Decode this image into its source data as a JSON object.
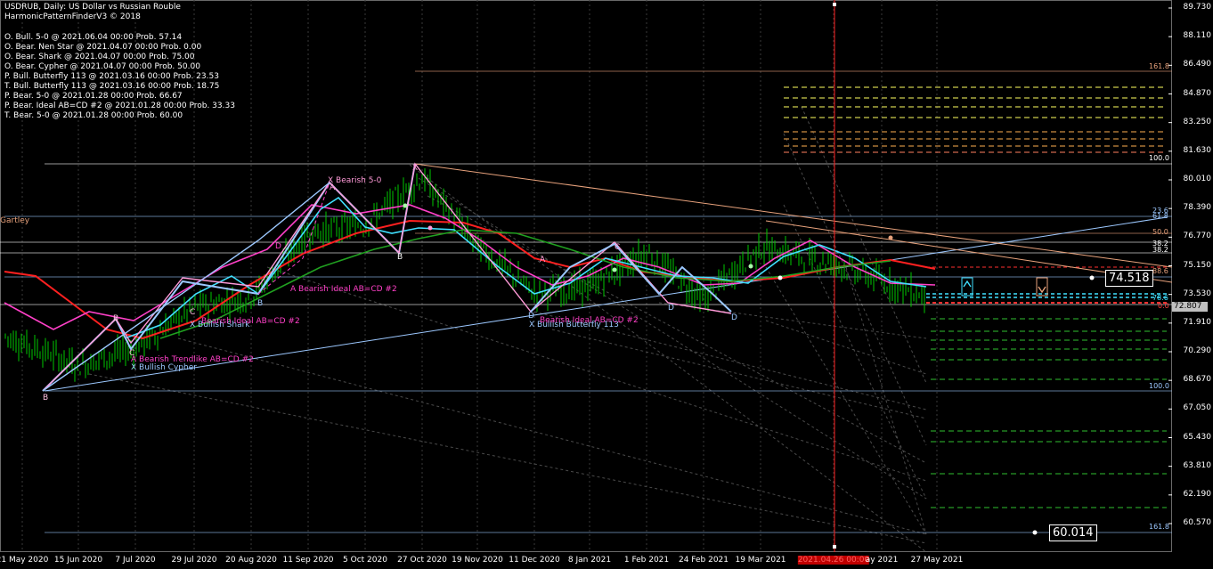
{
  "header": {
    "title": "USDRUB, Daily:  US Dollar vs Russian Rouble",
    "indicator": "HarmonicPatternFinderV3 © 2018"
  },
  "pattern_list": [
    "O. Bull. 5-0 @ 2021.06.04 00:00 Prob. 57.14",
    "O. Bear. Nen Star @ 2021.04.07 00:00 Prob. 0.00",
    "O. Bear. Shark @ 2021.04.07 00:00 Prob. 75.00",
    "O. Bear. Cypher @ 2021.04.07 00:00 Prob. 50.00",
    "P. Bull. Butterfly 113 @ 2021.03.16 00:00 Prob. 23.53",
    "T. Bull. Butterfly 113 @ 2021.03.16 00:00 Prob. 18.75",
    "P. Bear. 5-0 @ 2021.01.28 00:00 Prob. 66.67",
    "P. Bear. Ideal AB=CD #2 @ 2021.01.28 00:00 Prob. 33.33",
    "T. Bear. 5-0 @ 2021.01.28 00:00 Prob. 60.00"
  ],
  "price_axis": [
    "89.730",
    "88.110",
    "86.490",
    "84.870",
    "83.250",
    "81.630",
    "80.010",
    "78.390",
    "76.770",
    "75.150",
    "73.530",
    "71.910",
    "70.290",
    "68.670",
    "67.050",
    "65.430",
    "63.810",
    "62.190",
    "60.570"
  ],
  "time_axis": [
    "21 May 2020",
    "15 Jun 2020",
    "7 Jul 2020",
    "29 Jul 2020",
    "20 Aug 2020",
    "11 Sep 2020",
    "5 Oct 2020",
    "27 Oct 2020",
    "19 Nov 2020",
    "11 Dec 2020",
    "8 Jan 2021",
    "1 Feb 2021",
    "24 Feb 2021",
    "19 Mar 2021",
    "2021.04.26 00:00",
    "ay 2021",
    "27 May 2021"
  ],
  "current_price_label": "72.807",
  "price_boxes": {
    "upper": "74.518",
    "lower": "60.014"
  },
  "fib_labels": {
    "top_1618": "161.8",
    "top_100": "100.0",
    "l236": "23.6",
    "l618": "61.8",
    "l500": "50.0",
    "l382": "38.2",
    "l382b": "38.2",
    "l886": "88.6",
    "l786": "78.6",
    "l00": "0.0",
    "bot_100": "100.0",
    "bot_1618": "161.8"
  },
  "annotations": {
    "bearish_50": "X Bearish 5-0",
    "bearish_ideal_abcd": "A Bearish Ideal AB=CD #2",
    "bullish_shark": "X Bullish Shark",
    "bearish_ideal_abcd_2": "Bearish Ideal AB=CD #2",
    "bearish_trendlike": "A Bearish Trendlike AB=CD #2",
    "bullish_cypher": "X Bullish Cypher",
    "bullish_butterfly": "X Bullish Butterfly 113",
    "bearish_ideal_abcd_3": "Bearish Ideal AB=CD #2",
    "gartley": "Gartley",
    "pt_b1": "B",
    "pt_c1": "C",
    "pt_b2": "B",
    "pt_c2": "C",
    "pt_d1": "D",
    "pt_b3": "B",
    "pt_a1": "A",
    "pt_b4": "B",
    "pt_d2": "D",
    "pt_x1": "X",
    "pt_d3": "D",
    "pt_d4": "D",
    "pt_a2": "A",
    "pt_c3": "C"
  },
  "colors": {
    "background": "#000000",
    "bars": "#00c800",
    "red_ma": "#ff2020",
    "magenta_ma": "#ff40c8",
    "cyan_ma": "#40e0ff",
    "green_ma": "#20a020",
    "pattern_lines": "#9cc8ff",
    "pattern_pink": "#ff9ad8",
    "vline": "#ff2020",
    "grid": "#3a3a3a"
  },
  "chart_data": {
    "type": "line",
    "title": "USDRUB, Daily:  US Dollar vs Russian Rouble",
    "xlabel": "",
    "ylabel": "",
    "ylim": [
      60.0,
      90.3
    ],
    "x": [
      "2020-05-21",
      "2020-06-15",
      "2020-07-07",
      "2020-07-29",
      "2020-08-20",
      "2020-09-11",
      "2020-10-05",
      "2020-10-27",
      "2020-11-19",
      "2020-12-11",
      "2021-01-08",
      "2021-02-01",
      "2021-02-24",
      "2021-03-19",
      "2021-04-26",
      "2021-05-27"
    ],
    "series": [
      {
        "values": [
          71.2,
          69.5,
          70.5,
          72.8,
          73.4,
          77.0,
          77.5,
          80.1,
          76.3,
          73.6,
          74.0,
          75.9,
          73.2,
          76.2,
          75.3,
          73.4
        ]
      }
    ]
  }
}
